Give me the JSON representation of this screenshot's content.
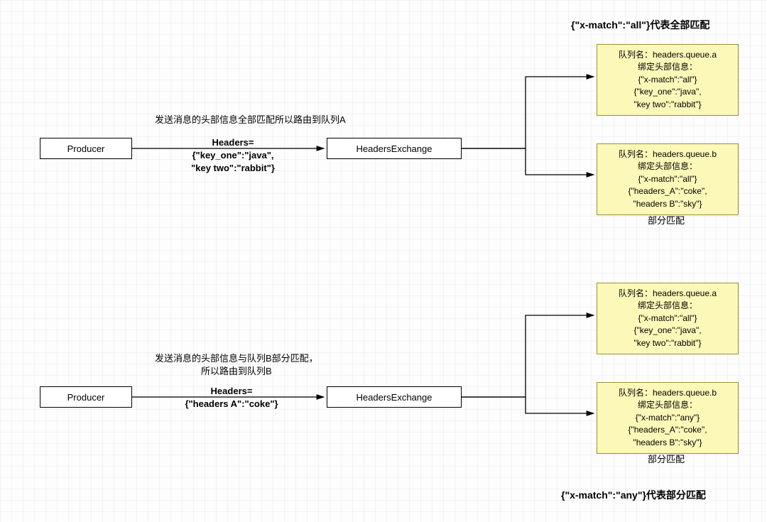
{
  "top": {
    "title": "{\"x-match\":\"all\"}代表全部匹配",
    "note": "发送消息的头部信息全部匹配所以路由到队列A",
    "producer": "Producer",
    "headers_title": "Headers=",
    "headers_body": "{\"key_one\":\"java\",\n\"key two\":\"rabbit\"}",
    "exchange": "HeadersExchange",
    "queueA": {
      "l1": "队列名：headers.queue.a",
      "l2": "绑定头部信息：",
      "l3": "{\"x-match\":\"all\"}",
      "l4": "{\"key_one\":\"java\",",
      "l5": "\"key two\":\"rabbit\"}"
    },
    "queueB": {
      "l1": "队列名：headers.queue.b",
      "l2": "绑定头部信息：",
      "l3": "{\"x-match\":\"all\"}",
      "l4": "{\"headers_A\":\"coke\",",
      "l5": "\"headers B\":\"sky\"}"
    },
    "partial": "部分匹配"
  },
  "bottom": {
    "note1": "发送消息的头部信息与队列B部分匹配，",
    "note2": "所以路由到队列B",
    "producer": "Producer",
    "headers_title": "Headers=",
    "headers_body": "{\"headers A\":\"coke\"}",
    "exchange": "HeadersExchange",
    "queueA": {
      "l1": "队列名：headers.queue.a",
      "l2": "绑定头部信息：",
      "l3": "{\"x-match\":\"all\"}",
      "l4": "{\"key_one\":\"java\",",
      "l5": "\"key two\":\"rabbit\"}"
    },
    "queueB": {
      "l1": "队列名：headers.queue.b",
      "l2": "绑定头部信息：",
      "l3": "{\"x-match\":\"any\"}",
      "l4": "{\"headers_A\":\"coke\",",
      "l5": "\"headers B\":\"sky\"}"
    },
    "partial": "部分匹配",
    "footer": "{\"x-match\":\"any\"}代表部分匹配"
  }
}
